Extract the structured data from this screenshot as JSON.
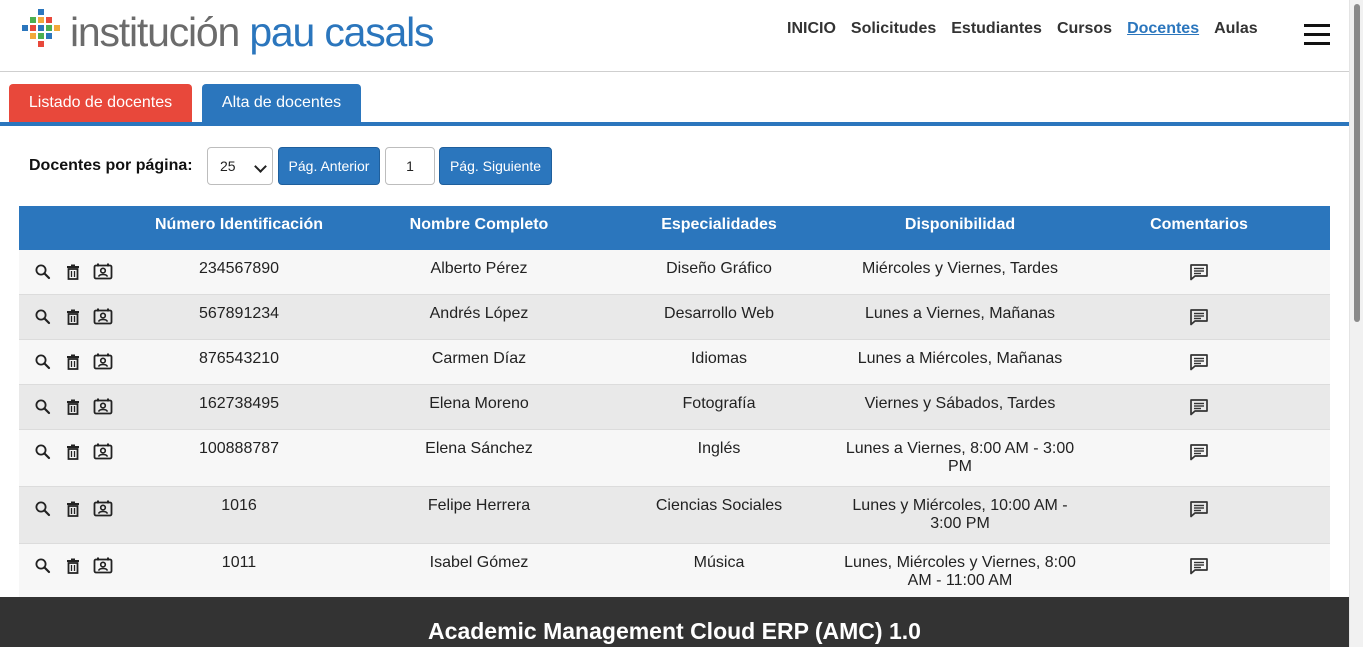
{
  "app": {
    "logo_word1": "institución",
    "logo_word2": "pau casals",
    "logo_colors": [
      "#e8483b",
      "#f2a93b",
      "#2b76bd",
      "#4caf50"
    ]
  },
  "nav": {
    "items": [
      "INICIO",
      "Solicitudes",
      "Estudiantes",
      "Cursos",
      "Docentes",
      "Aulas"
    ],
    "active": "Docentes"
  },
  "tabs": {
    "list_label": "Listado de docentes",
    "add_label": "Alta de docentes"
  },
  "pager": {
    "label": "Docentes por página:",
    "per_page": "25",
    "prev_label": "Pág. Anterior",
    "page": "1",
    "next_label": "Pág. Siguiente"
  },
  "table": {
    "columns": [
      "Número Identificación",
      "Nombre Completo",
      "Especialidades",
      "Disponibilidad",
      "Comentarios"
    ],
    "rows": [
      {
        "id": "234567890",
        "name": "Alberto Pérez",
        "specialty": "Diseño Gráfico",
        "availability": "Miércoles y Viernes, Tardes"
      },
      {
        "id": "567891234",
        "name": "Andrés López",
        "specialty": "Desarrollo Web",
        "availability": "Lunes a Viernes, Mañanas"
      },
      {
        "id": "876543210",
        "name": "Carmen Díaz",
        "specialty": "Idiomas",
        "availability": "Lunes a Miércoles, Mañanas"
      },
      {
        "id": "162738495",
        "name": "Elena Moreno",
        "specialty": "Fotografía",
        "availability": "Viernes y Sábados, Tardes"
      },
      {
        "id": "100888787",
        "name": "Elena Sánchez",
        "specialty": "Inglés",
        "availability": "Lunes a Viernes, 8:00 AM - 3:00 PM"
      },
      {
        "id": "1016",
        "name": "Felipe Herrera",
        "specialty": "Ciencias Sociales",
        "availability": "Lunes y Miércoles, 10:00 AM - 3:00 PM"
      },
      {
        "id": "1011",
        "name": "Isabel Gómez",
        "specialty": "Música",
        "availability": "Lunes, Miércoles y Viernes, 8:00 AM - 11:00 AM"
      }
    ]
  },
  "footer": {
    "text": "Academic Management Cloud ERP (AMC) 1.0"
  },
  "icons": {
    "row_actions": [
      "search-icon",
      "trash-icon",
      "contact-card-icon"
    ],
    "comment": "comment-icon",
    "menu": "hamburger-menu-icon"
  },
  "colors": {
    "primary": "#2b76bd",
    "danger": "#e8483b",
    "footer_bg": "#333333"
  }
}
